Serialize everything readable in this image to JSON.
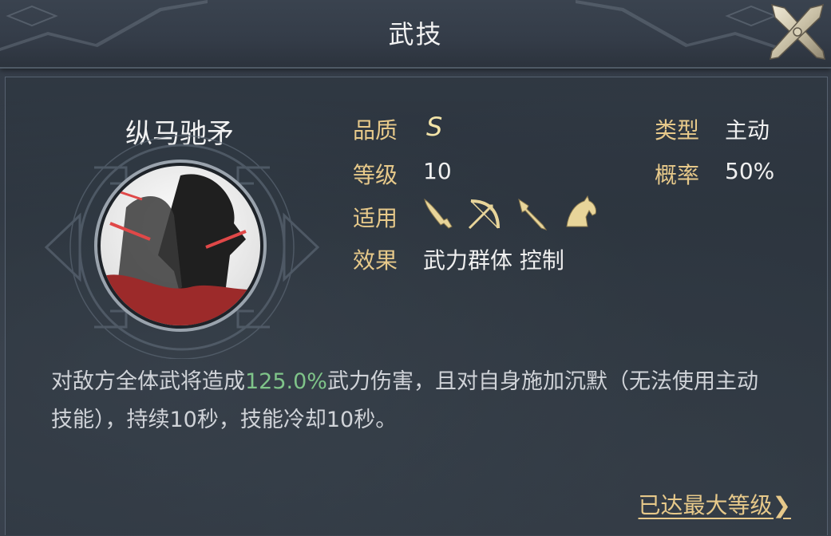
{
  "header": {
    "title": "武技"
  },
  "skill": {
    "name": "纵马驰矛",
    "quality_label": "品质",
    "quality_value": "S",
    "level_label": "等级",
    "level_value": "10",
    "applicable_label": "适用",
    "applicable_icons": [
      "sword-icon",
      "bow-icon",
      "spear-icon",
      "horse-icon"
    ],
    "effect_label": "效果",
    "effect_value": "武力群体 控制",
    "type_label": "类型",
    "type_value": "主动",
    "chance_label": "概率",
    "chance_value": "50%"
  },
  "description": {
    "part1": "对敌方全体武将造成",
    "highlight": "125.0%",
    "part2": "武力伤害，且对自身施加沉默（无法使用主动技能），持续10秒，技能冷却10秒。"
  },
  "footer": {
    "max_level_label": "已达最大等级",
    "arrow": "❯"
  },
  "colors": {
    "gold": "#e7c98a",
    "highlight_green": "#7fc489",
    "background": "#2c3440"
  }
}
